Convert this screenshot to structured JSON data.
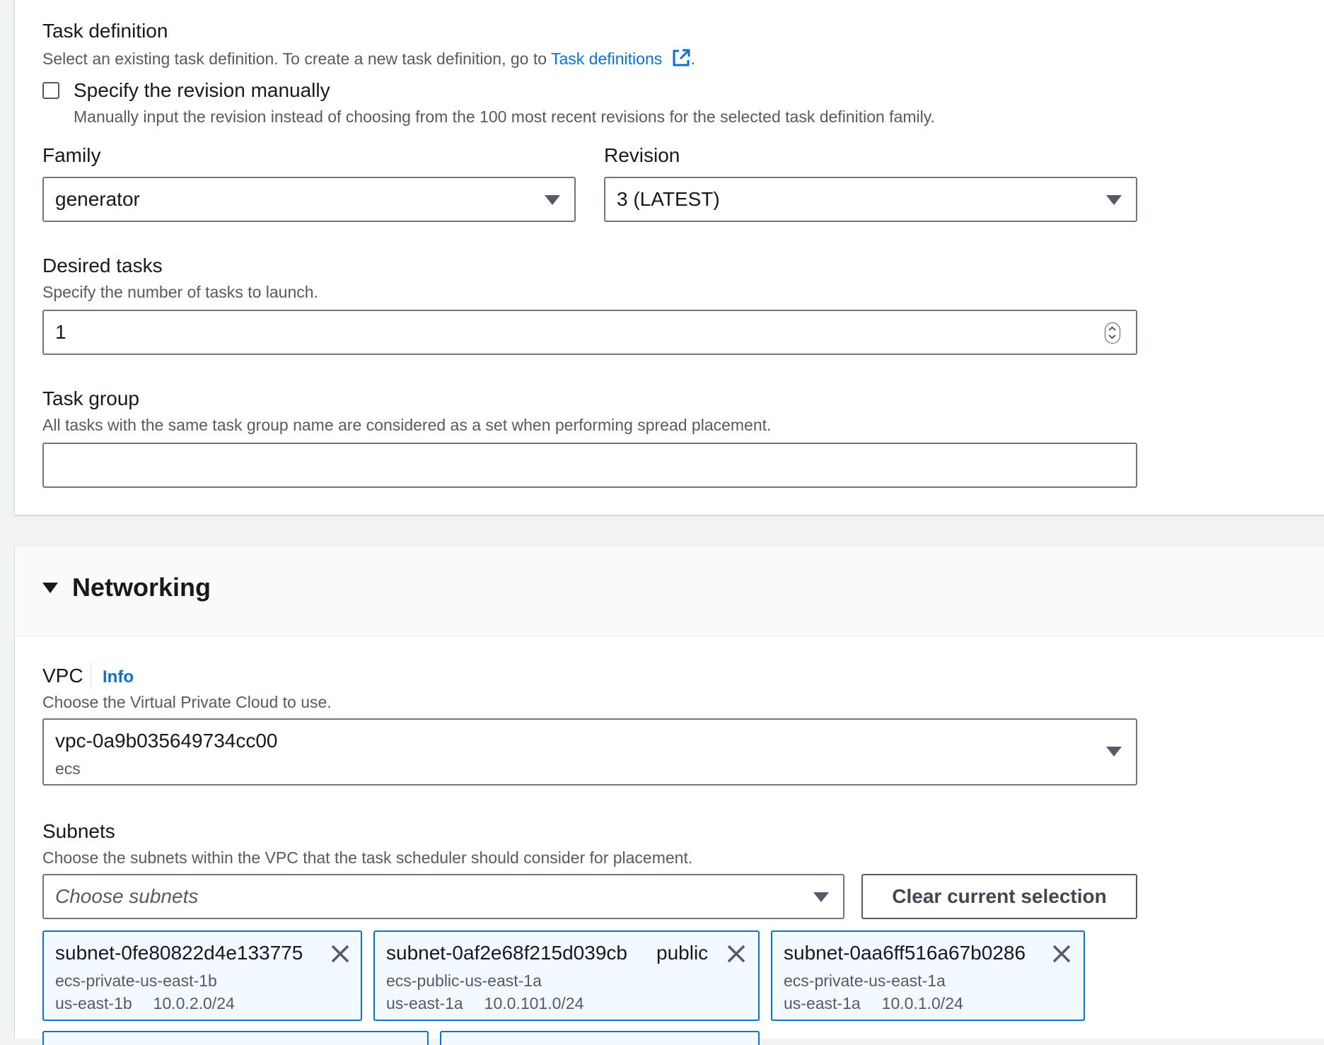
{
  "task_definition": {
    "label": "Task definition",
    "description_prefix": "Select an existing task definition. To create a new task definition, go to ",
    "link_text": "Task definitions",
    "description_suffix": ".",
    "manual_checkbox": {
      "label": "Specify the revision manually",
      "description": "Manually input the revision instead of choosing from the 100 most recent revisions for the selected task definition family.",
      "checked": false
    },
    "family": {
      "label": "Family",
      "value": "generator"
    },
    "revision": {
      "label": "Revision",
      "value": "3 (LATEST)"
    }
  },
  "desired_tasks": {
    "label": "Desired tasks",
    "description": "Specify the number of tasks to launch.",
    "value": "1"
  },
  "task_group": {
    "label": "Task group",
    "description": "All tasks with the same task group name are considered as a set when performing spread placement.",
    "value": ""
  },
  "networking": {
    "title": "Networking",
    "vpc": {
      "label": "VPC",
      "info": "Info",
      "description": "Choose the Virtual Private Cloud to use.",
      "value": "vpc-0a9b035649734cc00",
      "sublabel": "ecs"
    },
    "subnets": {
      "label": "Subnets",
      "description": "Choose the subnets within the VPC that the task scheduler should consider for placement.",
      "placeholder": "Choose subnets",
      "clear_button": "Clear current selection",
      "selected": [
        {
          "id": "subnet-0fe80822d4e133775",
          "tag": "",
          "name": "ecs-private-us-east-1b",
          "az": "us-east-1b",
          "cidr": "10.0.2.0/24"
        },
        {
          "id": "subnet-0af2e68f215d039cb",
          "tag": "public",
          "name": "ecs-public-us-east-1a",
          "az": "us-east-1a",
          "cidr": "10.0.101.0/24"
        },
        {
          "id": "subnet-0aa6ff516a67b0286",
          "tag": "",
          "name": "ecs-private-us-east-1a",
          "az": "us-east-1a",
          "cidr": "10.0.1.0/24"
        }
      ]
    }
  },
  "colors": {
    "link": "#0972d3",
    "token_border": "#0972d3",
    "token_bg": "#f1faff",
    "text": "#16191f",
    "secondary_text": "#545b64",
    "page_bg": "#f2f3f3"
  },
  "icons": {
    "external_link": "external-link-icon",
    "caret": "caret-down-icon",
    "remove": "close-icon",
    "stepper": "stepper-icon",
    "section_toggle": "caret-down-icon"
  }
}
